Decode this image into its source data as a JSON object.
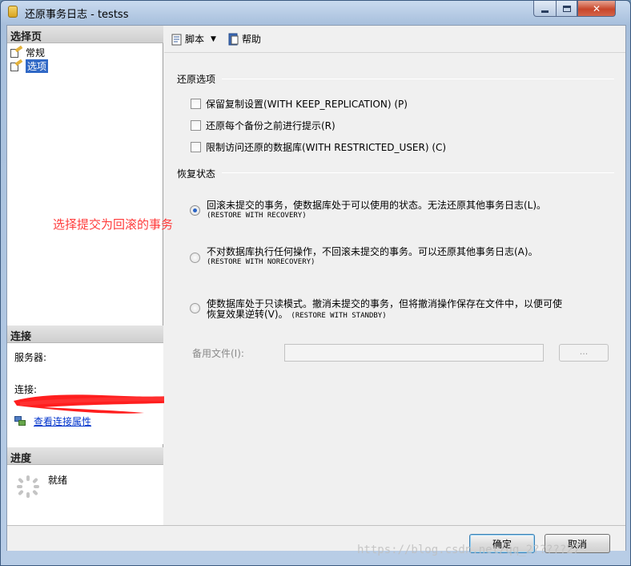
{
  "window": {
    "title": "还原事务日志 - testss"
  },
  "left": {
    "select_page_header": "选择页",
    "pages": [
      {
        "label": "常规",
        "selected": false
      },
      {
        "label": "选项",
        "selected": true
      }
    ],
    "connection_header": "连接",
    "server_label": "服务器:",
    "connection_label": "连接:",
    "view_properties_link": "查看连接属性",
    "progress_header": "进度",
    "progress_status": "就绪"
  },
  "toolbar": {
    "script_label": "脚本",
    "help_label": "帮助"
  },
  "restore_options": {
    "section_title": "还原选项",
    "checkboxes": [
      {
        "label": "保留复制设置(WITH KEEP_REPLICATION) (P)",
        "checked": false
      },
      {
        "label": "还原每个备份之前进行提示(R)",
        "checked": false
      },
      {
        "label": "限制访问还原的数据库(WITH RESTRICTED_USER) (C)",
        "checked": false
      }
    ]
  },
  "recovery_state": {
    "section_title": "恢复状态",
    "annotation": "选择提交为回滚的事务",
    "options": [
      {
        "text": "回滚未提交的事务，使数据库处于可以使用的状态。无法还原其他事务日志(L)。",
        "sub": "(RESTORE WITH RECOVERY)",
        "selected": true
      },
      {
        "text": "不对数据库执行任何操作，不回滚未提交的事务。可以还原其他事务日志(A)。",
        "sub": "(RESTORE WITH NORECOVERY)",
        "selected": false
      },
      {
        "text": "使数据库处于只读模式。撤消未提交的事务，但将撤消操作保存在文件中，以便可使",
        "text2": "恢复效果逆转(V)。",
        "sub": "(RESTORE WITH STANDBY)",
        "selected": false
      }
    ],
    "standby_file_label": "备用文件(I):",
    "standby_file_value": "",
    "browse_label": "..."
  },
  "buttons": {
    "ok": "确定",
    "cancel": "取消"
  },
  "watermark": "https://blog.csdn.net/qq_2?????27",
  "colors": {
    "annotation": "#ff3b3b",
    "accent": "#3169c6",
    "redaction": "#ff1e1e"
  }
}
